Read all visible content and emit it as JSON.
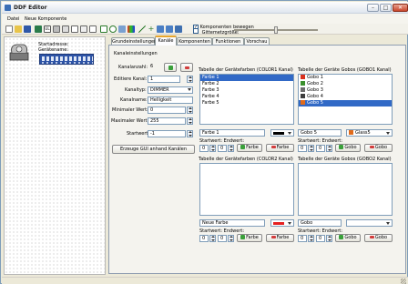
{
  "window": {
    "title": "DDF Editor"
  },
  "menu": [
    "Datei",
    "Neue Komponente"
  ],
  "toolbar": {
    "move_components_label": "Komponenten bewegen",
    "grid_size_label": "Gittemetzgröße:"
  },
  "left": {
    "start_address_label": "Startadresse:",
    "device_name_label": "Gerätename:"
  },
  "tabs": [
    "Grundeinstellungen",
    "Kanäle",
    "Komponenten",
    "Funktionen",
    "Vorschau"
  ],
  "channel_settings": {
    "group_title": "Kanaleinstellungen",
    "count_label": "Kanalanzahl:",
    "count_value": "6",
    "edit_label": "Editiere Kanal:",
    "edit_value": "1",
    "type_label": "Kanaltyp:",
    "type_value": "DIMMER",
    "name_label": "Kanalname:",
    "name_value": "Helligkeit",
    "min_label": "Minimaler Wert:",
    "min_value": "0",
    "max_label": "Maximaler Wert:",
    "max_value": "255",
    "start_label": "Startwert:",
    "start_value": "-1",
    "generate_button": "Erzeuge GUI anhand Kanälen"
  },
  "color1": {
    "title": "Tabelle der Gerätefarben (COLOR1 Kanal)",
    "items": [
      "Farbe 1",
      "Farbe 2",
      "Farbe 3",
      "Farbe 4",
      "Farbe 5"
    ],
    "selected_index": 0,
    "name_value": "Farbe 1",
    "color_hex": "#000000",
    "range_label": "Startwert: Endwert:",
    "start": "0",
    "end": "0",
    "add_label": "Farbe",
    "remove_label": "Farbe"
  },
  "gobo1": {
    "title": "Tabelle der Geräte Gobos (GOBO1 Kanal)",
    "items": [
      "Gobo 1",
      "Gobo 2",
      "Gobo 3",
      "Gobo 4",
      "Gobo 5"
    ],
    "selected_index": 4,
    "name_value": "Gobo 5",
    "image_value": "Glass5",
    "range_label": "Startwert: Endwert:",
    "start": "0",
    "end": "0",
    "add_label": "Gobo",
    "remove_label": "Gobo"
  },
  "color2": {
    "title": "Tabelle der Gerätefarben (COLOR2 Kanal)",
    "name_value": "Neue Farbe",
    "color_hex": "#e52020",
    "range_label": "Startwert: Endwert:",
    "start": "0",
    "end": "0",
    "add_label": "Farbe",
    "remove_label": "Farbe"
  },
  "gobo2": {
    "title": "Tabelle der Geräte Gobos (GOBO2 Kanal)",
    "name_value": "Gobo",
    "image_value": "",
    "range_label": "Startwert: Endwert:",
    "start": "0",
    "end": "0",
    "add_label": "Gobo",
    "remove_label": "Gobo"
  },
  "colors": {
    "gobo_swatches": [
      "#d9301c",
      "#3a8f2c",
      "#6b6b6b",
      "#3d3d3d",
      "#e06a1a"
    ]
  }
}
